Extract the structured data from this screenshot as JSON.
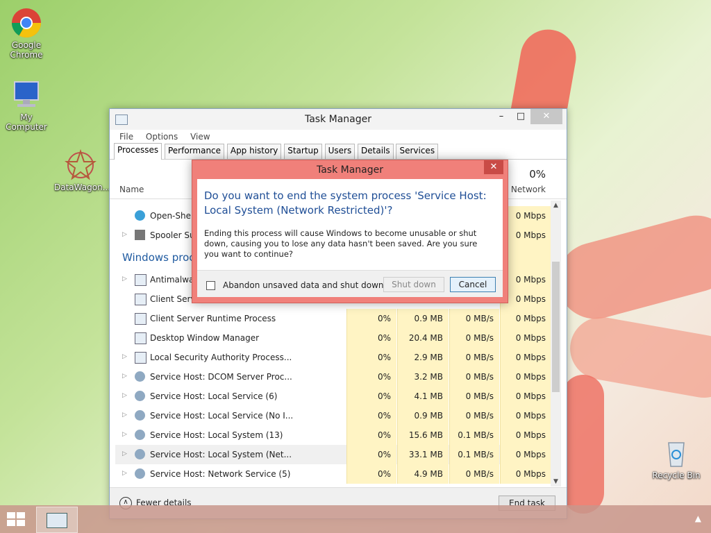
{
  "desktop": {
    "icons": [
      {
        "label": "Google Chrome"
      },
      {
        "label": "My Computer"
      },
      {
        "label": "DataWagon..."
      },
      {
        "label": "Recycle Bin"
      }
    ]
  },
  "taskmanager": {
    "title": "Task Manager",
    "menu": [
      "File",
      "Options",
      "View"
    ],
    "tabs": [
      "Processes",
      "Performance",
      "App history",
      "Startup",
      "Users",
      "Details",
      "Services"
    ],
    "column_name": "Name",
    "network_percent": "0%",
    "network_label": "Network",
    "rows_top": [
      {
        "name": "Open-Shell",
        "net": "0 Mbps"
      },
      {
        "name": "Spooler Sub",
        "net": "0 Mbps"
      }
    ],
    "group_label": "Windows proc",
    "rows": [
      {
        "name": "Antimalwar",
        "cpu": "",
        "mem": "",
        "disk": "",
        "net": "0 Mbps"
      },
      {
        "name": "Client Server Runtime Process",
        "cpu": "",
        "mem": "",
        "disk": "",
        "net": "0 Mbps"
      },
      {
        "name": "Client Server Runtime Process",
        "cpu": "0%",
        "mem": "0.9 MB",
        "disk": "0 MB/s",
        "net": "0 Mbps"
      },
      {
        "name": "Desktop Window Manager",
        "cpu": "0%",
        "mem": "20.4 MB",
        "disk": "0 MB/s",
        "net": "0 Mbps"
      },
      {
        "name": "Local Security Authority Process...",
        "cpu": "0%",
        "mem": "2.9 MB",
        "disk": "0 MB/s",
        "net": "0 Mbps"
      },
      {
        "name": "Service Host: DCOM Server Proc...",
        "cpu": "0%",
        "mem": "3.2 MB",
        "disk": "0 MB/s",
        "net": "0 Mbps"
      },
      {
        "name": "Service Host: Local Service (6)",
        "cpu": "0%",
        "mem": "4.1 MB",
        "disk": "0 MB/s",
        "net": "0 Mbps"
      },
      {
        "name": "Service Host: Local Service (No I...",
        "cpu": "0%",
        "mem": "0.9 MB",
        "disk": "0 MB/s",
        "net": "0 Mbps"
      },
      {
        "name": "Service Host: Local System (13)",
        "cpu": "0%",
        "mem": "15.6 MB",
        "disk": "0.1 MB/s",
        "net": "0 Mbps"
      },
      {
        "name": "Service Host: Local System (Net...",
        "cpu": "0%",
        "mem": "33.1 MB",
        "disk": "0.1 MB/s",
        "net": "0 Mbps"
      },
      {
        "name": "Service Host: Network Service (5)",
        "cpu": "0%",
        "mem": "4.9 MB",
        "disk": "0 MB/s",
        "net": "0 Mbps"
      }
    ],
    "fewer_details": "Fewer details",
    "end_task": "End task"
  },
  "dialog": {
    "title": "Task Manager",
    "close": "✕",
    "question": "Do you want to end the system process 'Service Host: Local System (Network Restricted)'?",
    "message": "Ending this process will cause Windows to become unusable or shut down, causing you to lose any data hasn't been saved. Are you sure you want to continue?",
    "checkbox_label": "Abandon unsaved data and shut down.",
    "shutdown_label": "Shut down",
    "cancel_label": "Cancel"
  },
  "colors": {
    "dialog_frame": "#f0807a",
    "question_text": "#1f4e96",
    "group_text": "#1f5aa0",
    "highlight": "#fff4c4"
  }
}
